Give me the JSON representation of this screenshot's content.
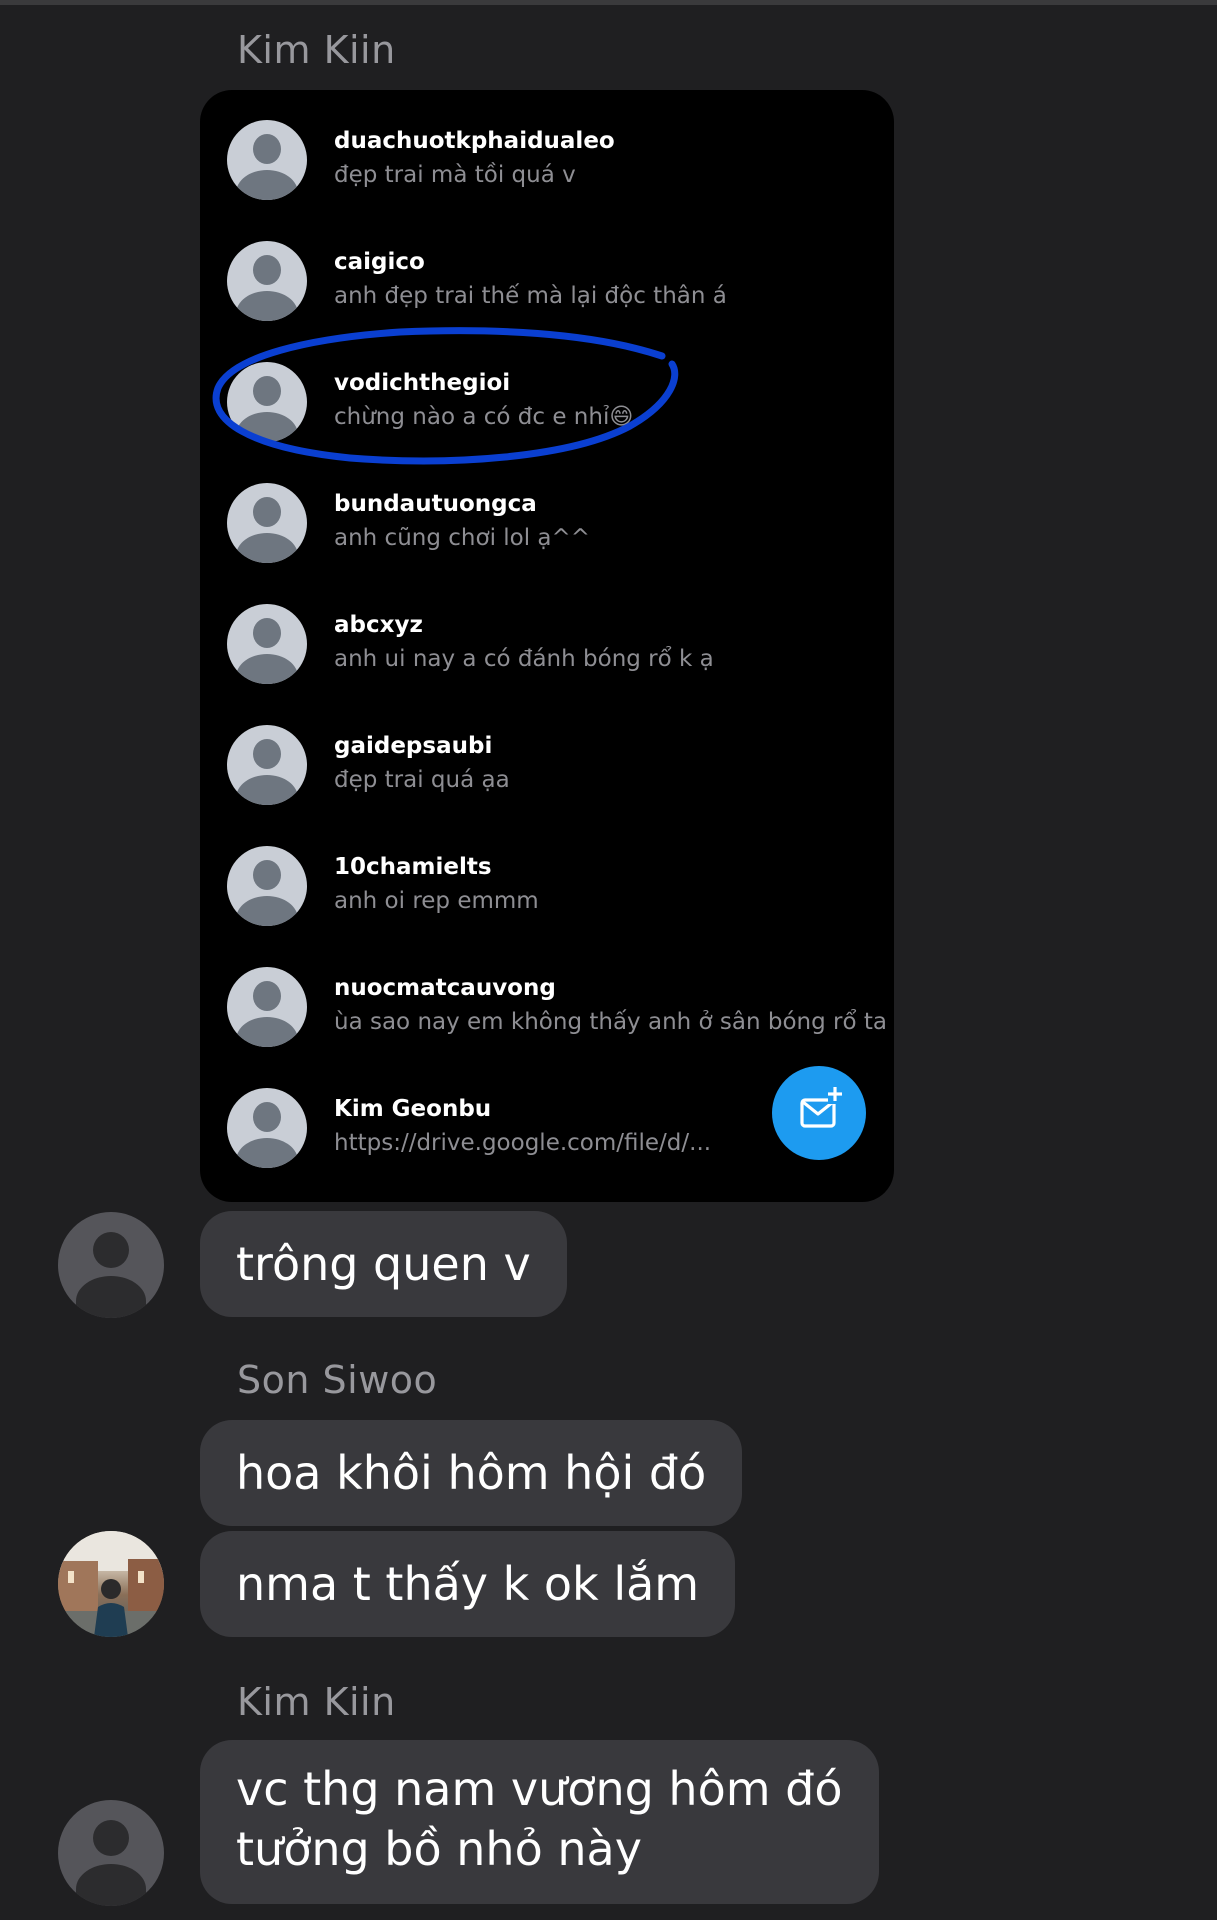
{
  "conversation": {
    "groups": [
      {
        "sender": "Kim Kiin",
        "shared_screenshot": {
          "dm_list": [
            {
              "username": "duachuotkphaidualeo",
              "preview": "đẹp trai mà tồi quá v"
            },
            {
              "username": "caigico",
              "preview": "anh đẹp trai thế mà lại độc thân á"
            },
            {
              "username": "vodichthegioi",
              "preview": "chừng nào a có đc e nhỉ😄",
              "circled": true
            },
            {
              "username": "bundautuongca",
              "preview": "anh cũng chơi lol ạ^^"
            },
            {
              "username": "abcxyz",
              "preview": "anh ui nay a có đánh bóng rổ k ạ"
            },
            {
              "username": "gaidepsaubi",
              "preview": "đẹp trai quá ạa"
            },
            {
              "username": "10chamielts",
              "preview": "anh oi rep emmm"
            },
            {
              "username": "nuocmatcauvong",
              "preview": "ùa sao nay em không thấy anh ở sân bóng rổ ta"
            },
            {
              "username": "Kim Geonbu",
              "preview": "https://drive.google.com/file/d/..."
            }
          ],
          "compose_icon": "compose-message-icon",
          "circle_color": "#0a3fd1",
          "fab_color": "#1d9bf0"
        },
        "messages": [
          "trông quen v"
        ]
      },
      {
        "sender": "Son Siwoo",
        "messages": [
          "hoa khôi hôm hội đó",
          "nma t thấy k ok lắm"
        ]
      },
      {
        "sender": "Kim Kiin",
        "messages": [
          [
            "vc thg nam vương hôm đó",
            "tưởng bồ nhỏ này"
          ]
        ]
      }
    ]
  },
  "colors": {
    "background": "#1f1f21",
    "bubble": "#39393d",
    "sender_name": "#98989d"
  }
}
